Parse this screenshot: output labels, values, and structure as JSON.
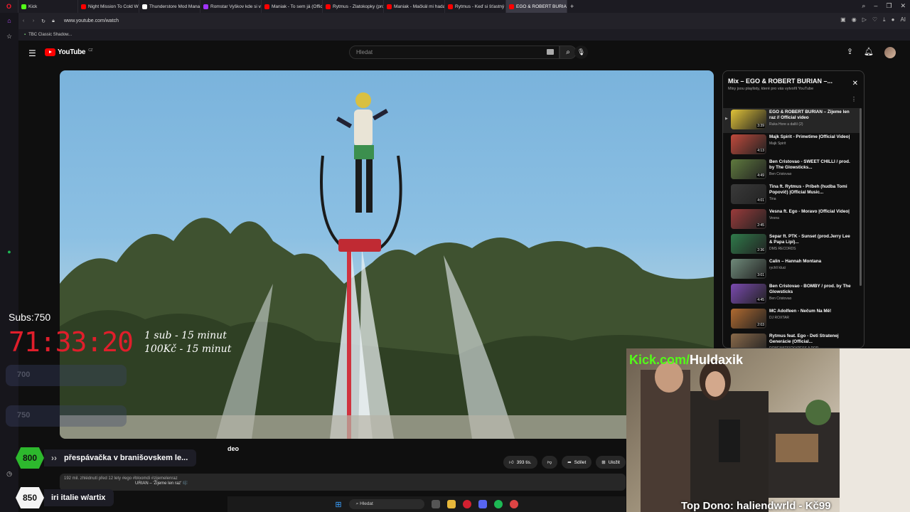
{
  "browser": {
    "tabs": [
      {
        "label": "Kick",
        "color": "#53fc18",
        "active": false
      },
      {
        "label": "Night Mission To Cold Wi",
        "color": "#ff0000",
        "active": false
      },
      {
        "label": "Thunderstore Mod Mana",
        "color": "#ffffff",
        "active": false
      },
      {
        "label": "Romstar Vyškov kde si vč",
        "color": "#a033ff",
        "active": false
      },
      {
        "label": "Maniak - To sem já (Offici",
        "color": "#ff0000",
        "active": false
      },
      {
        "label": "Rytmus - Zlatokopky (pro",
        "color": "#ff0000",
        "active": false
      },
      {
        "label": "Maniak - Mačkál mi hada",
        "color": "#ff0000",
        "active": false
      },
      {
        "label": "Rytmus - Keď si šťastný",
        "color": "#ff0000",
        "active": false
      },
      {
        "label": "EGO & ROBERT BURIAN",
        "color": "#ff0000",
        "active": true
      }
    ],
    "url": "www.youtube.com/watch",
    "bookmark": "TBC Classic Shadow..."
  },
  "youtube": {
    "region": "CZ",
    "logo_text": "YouTube",
    "search_placeholder": "Hledat",
    "video_title_tail": "deo",
    "likes": "393 tis.",
    "share_label": "Sdílet",
    "save_label": "Uložit",
    "desc_line1": "192 mil. zhlédnutí  před 12 lety  #ego #bloomdi #zijemelenraz",
    "desc_line2": "URIAN – 'Žijeme len raz' 🎼"
  },
  "playlist": {
    "title": "Mix – EGO & ROBERT BURIAN –...",
    "subtitle": "Mixy jsou playlisty, které pro vás vytvořil YouTube",
    "items": [
      {
        "title": "EGO & ROBERT BURIAN – Žijeme len raz // Official video",
        "channel": "Ruka Hore a další (2)",
        "duration": "3:39",
        "color": "#e0c238"
      },
      {
        "title": "Majk Spirit - Primetime |Official Video|",
        "channel": "Majk Spirit",
        "duration": "4:13",
        "color": "#c04a3c"
      },
      {
        "title": "Ben Cristovao - SWEET CHILLI / prod. by The Glowsticks...",
        "channel": "Ben Cristovao",
        "duration": "4:49",
        "color": "#5f7a3e"
      },
      {
        "title": "Tina ft. Rytmus - Príbeh (hudba Tomi Popovič) |Official Music...",
        "channel": "Tina",
        "duration": "4:01",
        "color": "#3a3a3a"
      },
      {
        "title": "Vesna ft. Ego - Moravo |Official Video|",
        "channel": "Vesna",
        "duration": "2:45",
        "color": "#9a3b3b"
      },
      {
        "title": "Separ ft. PTK - Sunset (prod.Jerry Lee & Papa Lipi)...",
        "channel": "DMS RECORDS",
        "duration": "2:36",
        "color": "#2f7a4a"
      },
      {
        "title": "Calin – Hannah Montana",
        "channel": "rychlí kluci",
        "duration": "3:01",
        "color": "#6f8a7a"
      },
      {
        "title": "Ben Cristovao - BOMBY / prod. by The Glowsticks",
        "channel": "Ben Cristovao",
        "duration": "4:45",
        "color": "#7a4ab0"
      },
      {
        "title": "MC Adolfeen - Nečum Na Mě!",
        "channel": "DJ ROXTAR",
        "duration": "2:03",
        "color": "#b06a30"
      },
      {
        "title": "Rytmus feat. Ego - Deti Stratenej Generácie (Official...",
        "channel": "DONEMATSICKYPESS A POP",
        "duration": "5:00",
        "color": "#8a6a4a"
      }
    ]
  },
  "stream": {
    "subs_label": "Subs:",
    "subs_value": "750",
    "timer": "71:33:20",
    "rate1": "1 sub - 15 minut",
    "rate2": "100Kč - 15 minut",
    "ghost_goals": [
      "700",
      "750"
    ],
    "goals": [
      {
        "amount": "800",
        "text": "přespávačka v branišovskem le...",
        "style": "green"
      },
      {
        "amount": "850",
        "text": "iri italie w/artix",
        "style": "white"
      }
    ],
    "kick_prefix": "Kick.com/",
    "kick_name": "Huldaxik",
    "top_dono": "Top Dono: haliendwrld - Kč99"
  },
  "taskbar": {
    "search": "Hledat"
  }
}
